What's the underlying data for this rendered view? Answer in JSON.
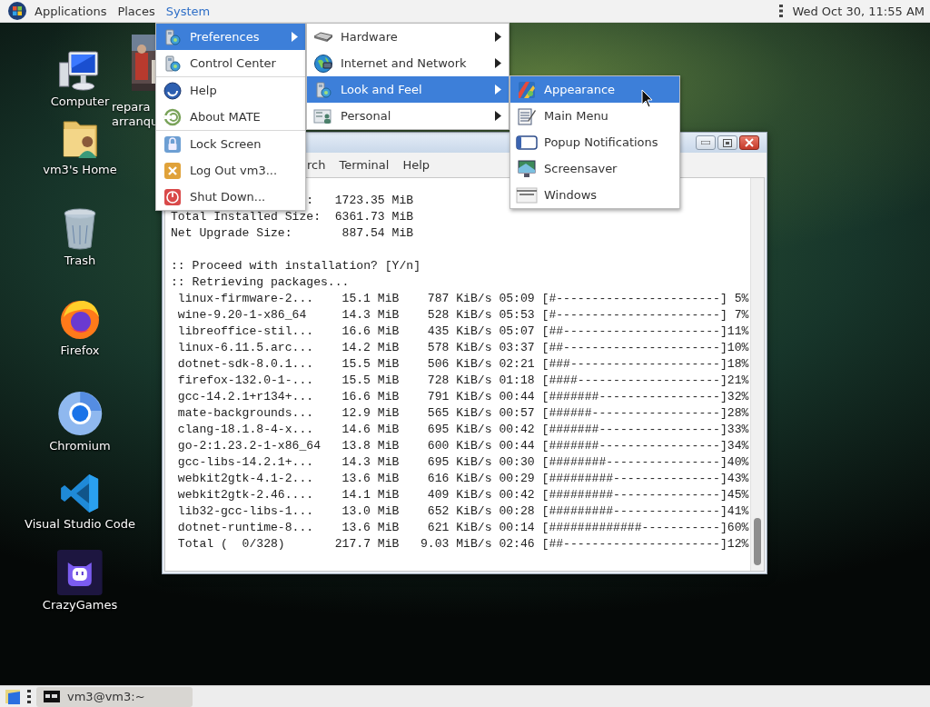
{
  "top_panel": {
    "menus": [
      {
        "label": "Applications",
        "selected": false
      },
      {
        "label": "Places",
        "selected": false
      },
      {
        "label": "System",
        "selected": true
      }
    ],
    "clock": "Wed Oct 30, 11:55 AM"
  },
  "desktop_icons": [
    {
      "label": "Computer"
    },
    {
      "label": "repara arranqu",
      "kind": "picture"
    },
    {
      "label": "vm3's Home"
    },
    {
      "label": "Trash"
    },
    {
      "label": "Firefox"
    },
    {
      "label": "Chromium"
    },
    {
      "label": "Visual Studio Code"
    },
    {
      "label": "CrazyGames"
    }
  ],
  "system_menu": {
    "items": [
      {
        "kind": "item",
        "label": "Preferences",
        "selected": true,
        "submenu": true
      },
      {
        "kind": "item",
        "label": "Control Center",
        "selected": false,
        "submenu": false
      },
      {
        "kind": "separator"
      },
      {
        "kind": "item",
        "label": "Help",
        "selected": false,
        "submenu": false
      },
      {
        "kind": "item",
        "label": "About MATE",
        "selected": false,
        "submenu": false
      },
      {
        "kind": "separator"
      },
      {
        "kind": "item",
        "label": "Lock Screen",
        "selected": false,
        "submenu": false
      },
      {
        "kind": "item",
        "label": "Log Out vm3...",
        "selected": false,
        "submenu": false
      },
      {
        "kind": "item",
        "label": "Shut Down...",
        "selected": false,
        "submenu": false
      }
    ]
  },
  "preferences_menu": {
    "items": [
      {
        "kind": "item",
        "label": "Hardware",
        "selected": false,
        "submenu": true
      },
      {
        "kind": "item",
        "label": "Internet and Network",
        "selected": false,
        "submenu": true
      },
      {
        "kind": "item",
        "label": "Look and Feel",
        "selected": true,
        "submenu": true
      },
      {
        "kind": "item",
        "label": "Personal",
        "selected": false,
        "submenu": true
      }
    ]
  },
  "look_and_feel_menu": {
    "items": [
      {
        "kind": "item",
        "label": "Appearance",
        "selected": true,
        "submenu": false
      },
      {
        "kind": "item",
        "label": "Main Menu",
        "selected": false,
        "submenu": false
      },
      {
        "kind": "item",
        "label": "Popup Notifications",
        "selected": false,
        "submenu": false
      },
      {
        "kind": "item",
        "label": "Screensaver",
        "selected": false,
        "submenu": false
      },
      {
        "kind": "item",
        "label": "Windows",
        "selected": false,
        "submenu": false
      }
    ]
  },
  "terminal": {
    "menubar": [
      {
        "label": "rch"
      },
      {
        "label": "Terminal"
      },
      {
        "label": "Help"
      }
    ],
    "summary": [
      {
        "label": ":",
        "value": "1723.35 MiB"
      },
      {
        "label": "Total Installed Size:",
        "value": "6361.73 MiB"
      },
      {
        "label": "Net Upgrade Size:",
        "value": "887.54 MiB"
      }
    ],
    "messages": [
      ":: Proceed with installation? [Y/n]",
      ":: Retrieving packages..."
    ],
    "downloads": [
      {
        "name": "linux-firmware-2...",
        "size": "15.1 MiB",
        "rate": "787 KiB/s",
        "eta": "05:09",
        "bar": "[#-----------------------]",
        "percent": "5%"
      },
      {
        "name": "wine-9.20-1-x86_64",
        "size": "14.3 MiB",
        "rate": "528 KiB/s",
        "eta": "05:53",
        "bar": "[#-----------------------]",
        "percent": "7%"
      },
      {
        "name": "libreoffice-stil...",
        "size": "16.6 MiB",
        "rate": "435 KiB/s",
        "eta": "05:07",
        "bar": "[##----------------------]",
        "percent": "11%"
      },
      {
        "name": "linux-6.11.5.arc...",
        "size": "14.2 MiB",
        "rate": "578 KiB/s",
        "eta": "03:37",
        "bar": "[##----------------------]",
        "percent": "10%"
      },
      {
        "name": "dotnet-sdk-8.0.1...",
        "size": "15.5 MiB",
        "rate": "506 KiB/s",
        "eta": "02:21",
        "bar": "[###---------------------]",
        "percent": "18%"
      },
      {
        "name": "firefox-132.0-1-...",
        "size": "15.5 MiB",
        "rate": "728 KiB/s",
        "eta": "01:18",
        "bar": "[####--------------------]",
        "percent": "21%"
      },
      {
        "name": "gcc-14.2.1+r134+...",
        "size": "16.6 MiB",
        "rate": "791 KiB/s",
        "eta": "00:44",
        "bar": "[#######-----------------]",
        "percent": "32%"
      },
      {
        "name": "mate-backgrounds...",
        "size": "12.9 MiB",
        "rate": "565 KiB/s",
        "eta": "00:57",
        "bar": "[######------------------]",
        "percent": "28%"
      },
      {
        "name": "clang-18.1.8-4-x...",
        "size": "14.6 MiB",
        "rate": "695 KiB/s",
        "eta": "00:42",
        "bar": "[#######-----------------]",
        "percent": "33%"
      },
      {
        "name": "go-2:1.23.2-1-x86_64",
        "size": "13.8 MiB",
        "rate": "600 KiB/s",
        "eta": "00:44",
        "bar": "[#######-----------------]",
        "percent": "34%"
      },
      {
        "name": "gcc-libs-14.2.1+...",
        "size": "14.3 MiB",
        "rate": "695 KiB/s",
        "eta": "00:30",
        "bar": "[########----------------]",
        "percent": "40%"
      },
      {
        "name": "webkit2gtk-4.1-2...",
        "size": "13.6 MiB",
        "rate": "616 KiB/s",
        "eta": "00:29",
        "bar": "[#########---------------]",
        "percent": "43%"
      },
      {
        "name": "webkit2gtk-2.46....",
        "size": "14.1 MiB",
        "rate": "409 KiB/s",
        "eta": "00:42",
        "bar": "[#########---------------]",
        "percent": "45%"
      },
      {
        "name": "lib32-gcc-libs-1...",
        "size": "13.0 MiB",
        "rate": "652 KiB/s",
        "eta": "00:28",
        "bar": "[#########---------------]",
        "percent": "41%"
      },
      {
        "name": "dotnet-runtime-8...",
        "size": "13.6 MiB",
        "rate": "621 KiB/s",
        "eta": "00:14",
        "bar": "[#############-----------]",
        "percent": "60%"
      },
      {
        "name": "Total (  0/328)",
        "size": "217.7 MiB",
        "rate": "9.03 MiB/s",
        "eta": "02:46",
        "bar": "[##----------------------]",
        "percent": "12%"
      }
    ]
  },
  "taskbar": {
    "tasks": [
      {
        "label": "vm3@vm3:~",
        "selected": false
      }
    ]
  }
}
